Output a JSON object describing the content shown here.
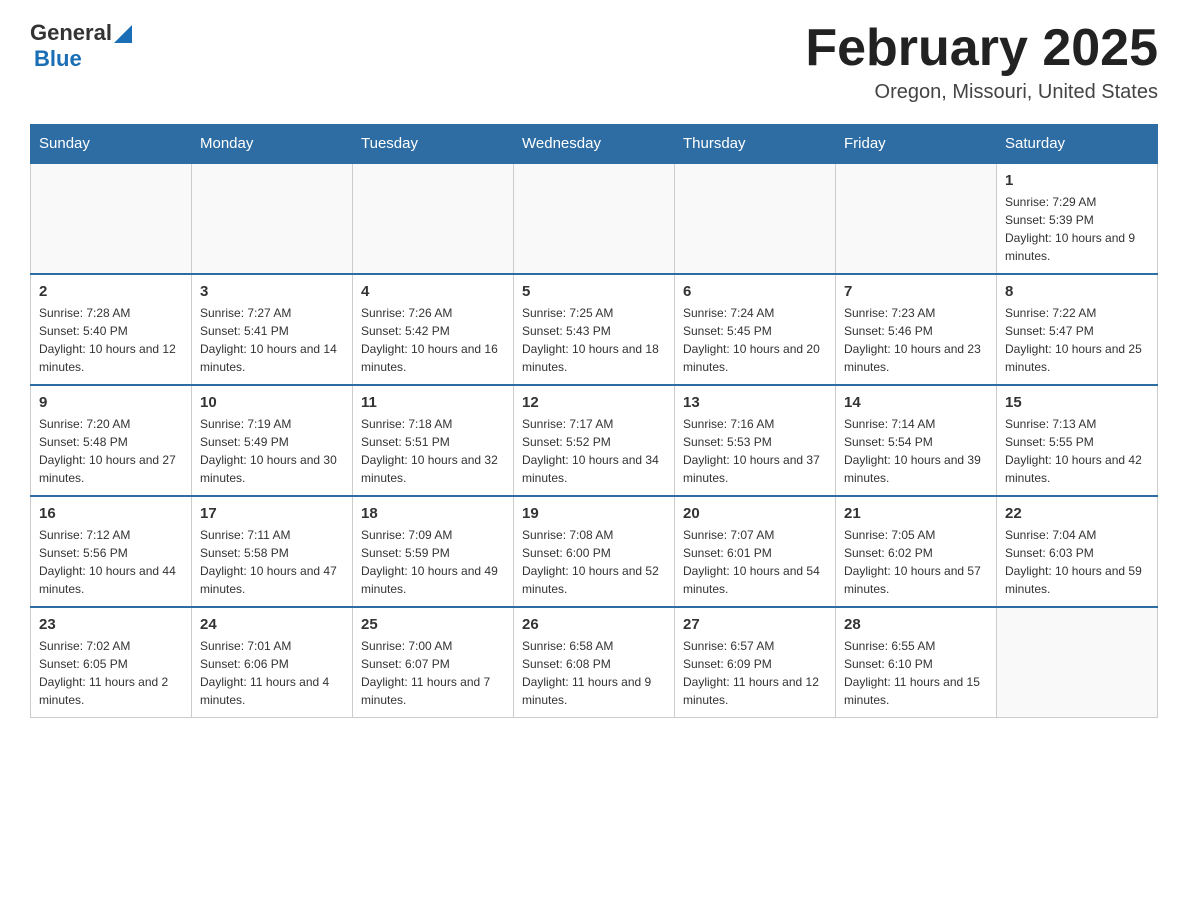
{
  "header": {
    "logo": {
      "general": "General",
      "triangle": "▲",
      "blue": "Blue"
    },
    "title": "February 2025",
    "location": "Oregon, Missouri, United States"
  },
  "days_of_week": [
    "Sunday",
    "Monday",
    "Tuesday",
    "Wednesday",
    "Thursday",
    "Friday",
    "Saturday"
  ],
  "weeks": [
    {
      "days": [
        {
          "number": "",
          "info": ""
        },
        {
          "number": "",
          "info": ""
        },
        {
          "number": "",
          "info": ""
        },
        {
          "number": "",
          "info": ""
        },
        {
          "number": "",
          "info": ""
        },
        {
          "number": "",
          "info": ""
        },
        {
          "number": "1",
          "info": "Sunrise: 7:29 AM\nSunset: 5:39 PM\nDaylight: 10 hours and 9 minutes."
        }
      ]
    },
    {
      "days": [
        {
          "number": "2",
          "info": "Sunrise: 7:28 AM\nSunset: 5:40 PM\nDaylight: 10 hours and 12 minutes."
        },
        {
          "number": "3",
          "info": "Sunrise: 7:27 AM\nSunset: 5:41 PM\nDaylight: 10 hours and 14 minutes."
        },
        {
          "number": "4",
          "info": "Sunrise: 7:26 AM\nSunset: 5:42 PM\nDaylight: 10 hours and 16 minutes."
        },
        {
          "number": "5",
          "info": "Sunrise: 7:25 AM\nSunset: 5:43 PM\nDaylight: 10 hours and 18 minutes."
        },
        {
          "number": "6",
          "info": "Sunrise: 7:24 AM\nSunset: 5:45 PM\nDaylight: 10 hours and 20 minutes."
        },
        {
          "number": "7",
          "info": "Sunrise: 7:23 AM\nSunset: 5:46 PM\nDaylight: 10 hours and 23 minutes."
        },
        {
          "number": "8",
          "info": "Sunrise: 7:22 AM\nSunset: 5:47 PM\nDaylight: 10 hours and 25 minutes."
        }
      ]
    },
    {
      "days": [
        {
          "number": "9",
          "info": "Sunrise: 7:20 AM\nSunset: 5:48 PM\nDaylight: 10 hours and 27 minutes."
        },
        {
          "number": "10",
          "info": "Sunrise: 7:19 AM\nSunset: 5:49 PM\nDaylight: 10 hours and 30 minutes."
        },
        {
          "number": "11",
          "info": "Sunrise: 7:18 AM\nSunset: 5:51 PM\nDaylight: 10 hours and 32 minutes."
        },
        {
          "number": "12",
          "info": "Sunrise: 7:17 AM\nSunset: 5:52 PM\nDaylight: 10 hours and 34 minutes."
        },
        {
          "number": "13",
          "info": "Sunrise: 7:16 AM\nSunset: 5:53 PM\nDaylight: 10 hours and 37 minutes."
        },
        {
          "number": "14",
          "info": "Sunrise: 7:14 AM\nSunset: 5:54 PM\nDaylight: 10 hours and 39 minutes."
        },
        {
          "number": "15",
          "info": "Sunrise: 7:13 AM\nSunset: 5:55 PM\nDaylight: 10 hours and 42 minutes."
        }
      ]
    },
    {
      "days": [
        {
          "number": "16",
          "info": "Sunrise: 7:12 AM\nSunset: 5:56 PM\nDaylight: 10 hours and 44 minutes."
        },
        {
          "number": "17",
          "info": "Sunrise: 7:11 AM\nSunset: 5:58 PM\nDaylight: 10 hours and 47 minutes."
        },
        {
          "number": "18",
          "info": "Sunrise: 7:09 AM\nSunset: 5:59 PM\nDaylight: 10 hours and 49 minutes."
        },
        {
          "number": "19",
          "info": "Sunrise: 7:08 AM\nSunset: 6:00 PM\nDaylight: 10 hours and 52 minutes."
        },
        {
          "number": "20",
          "info": "Sunrise: 7:07 AM\nSunset: 6:01 PM\nDaylight: 10 hours and 54 minutes."
        },
        {
          "number": "21",
          "info": "Sunrise: 7:05 AM\nSunset: 6:02 PM\nDaylight: 10 hours and 57 minutes."
        },
        {
          "number": "22",
          "info": "Sunrise: 7:04 AM\nSunset: 6:03 PM\nDaylight: 10 hours and 59 minutes."
        }
      ]
    },
    {
      "days": [
        {
          "number": "23",
          "info": "Sunrise: 7:02 AM\nSunset: 6:05 PM\nDaylight: 11 hours and 2 minutes."
        },
        {
          "number": "24",
          "info": "Sunrise: 7:01 AM\nSunset: 6:06 PM\nDaylight: 11 hours and 4 minutes."
        },
        {
          "number": "25",
          "info": "Sunrise: 7:00 AM\nSunset: 6:07 PM\nDaylight: 11 hours and 7 minutes."
        },
        {
          "number": "26",
          "info": "Sunrise: 6:58 AM\nSunset: 6:08 PM\nDaylight: 11 hours and 9 minutes."
        },
        {
          "number": "27",
          "info": "Sunrise: 6:57 AM\nSunset: 6:09 PM\nDaylight: 11 hours and 12 minutes."
        },
        {
          "number": "28",
          "info": "Sunrise: 6:55 AM\nSunset: 6:10 PM\nDaylight: 11 hours and 15 minutes."
        },
        {
          "number": "",
          "info": ""
        }
      ]
    }
  ]
}
